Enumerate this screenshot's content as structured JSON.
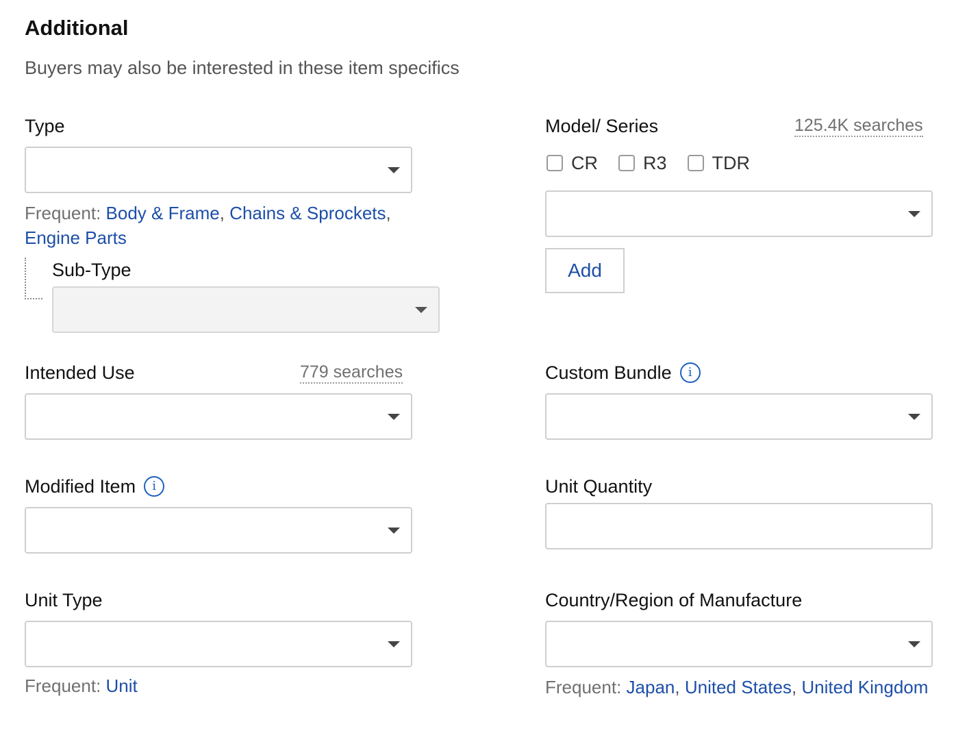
{
  "header": {
    "title": "Additional",
    "subtitle": "Buyers may also be interested in these item specifics"
  },
  "type": {
    "label": "Type",
    "value": "",
    "frequent_prefix": "Frequent:",
    "frequent": [
      "Body & Frame",
      "Chains & Sprockets",
      "Engine Parts"
    ],
    "sub_type": {
      "label": "Sub-Type",
      "value": ""
    }
  },
  "model_series": {
    "label": "Model/ Series",
    "searches": "125.4K searches",
    "options": [
      "CR",
      "R3",
      "TDR"
    ],
    "value": "",
    "add_label": "Add"
  },
  "intended_use": {
    "label": "Intended Use",
    "searches": "779 searches",
    "value": ""
  },
  "custom_bundle": {
    "label": "Custom Bundle",
    "icon": "info-icon",
    "value": ""
  },
  "modified_item": {
    "label": "Modified Item",
    "icon": "info-icon",
    "value": ""
  },
  "unit_quantity": {
    "label": "Unit Quantity",
    "value": ""
  },
  "unit_type": {
    "label": "Unit Type",
    "value": "",
    "frequent_prefix": "Frequent:",
    "frequent": [
      "Unit"
    ]
  },
  "country": {
    "label": "Country/Region of Manufacture",
    "value": "",
    "frequent_prefix": "Frequent:",
    "frequent": [
      "Japan",
      "United States",
      "United Kingdom"
    ]
  },
  "colors": {
    "link": "#1d4fa8",
    "info_icon": "#1d5fc2",
    "border": "#cfcfcf"
  }
}
